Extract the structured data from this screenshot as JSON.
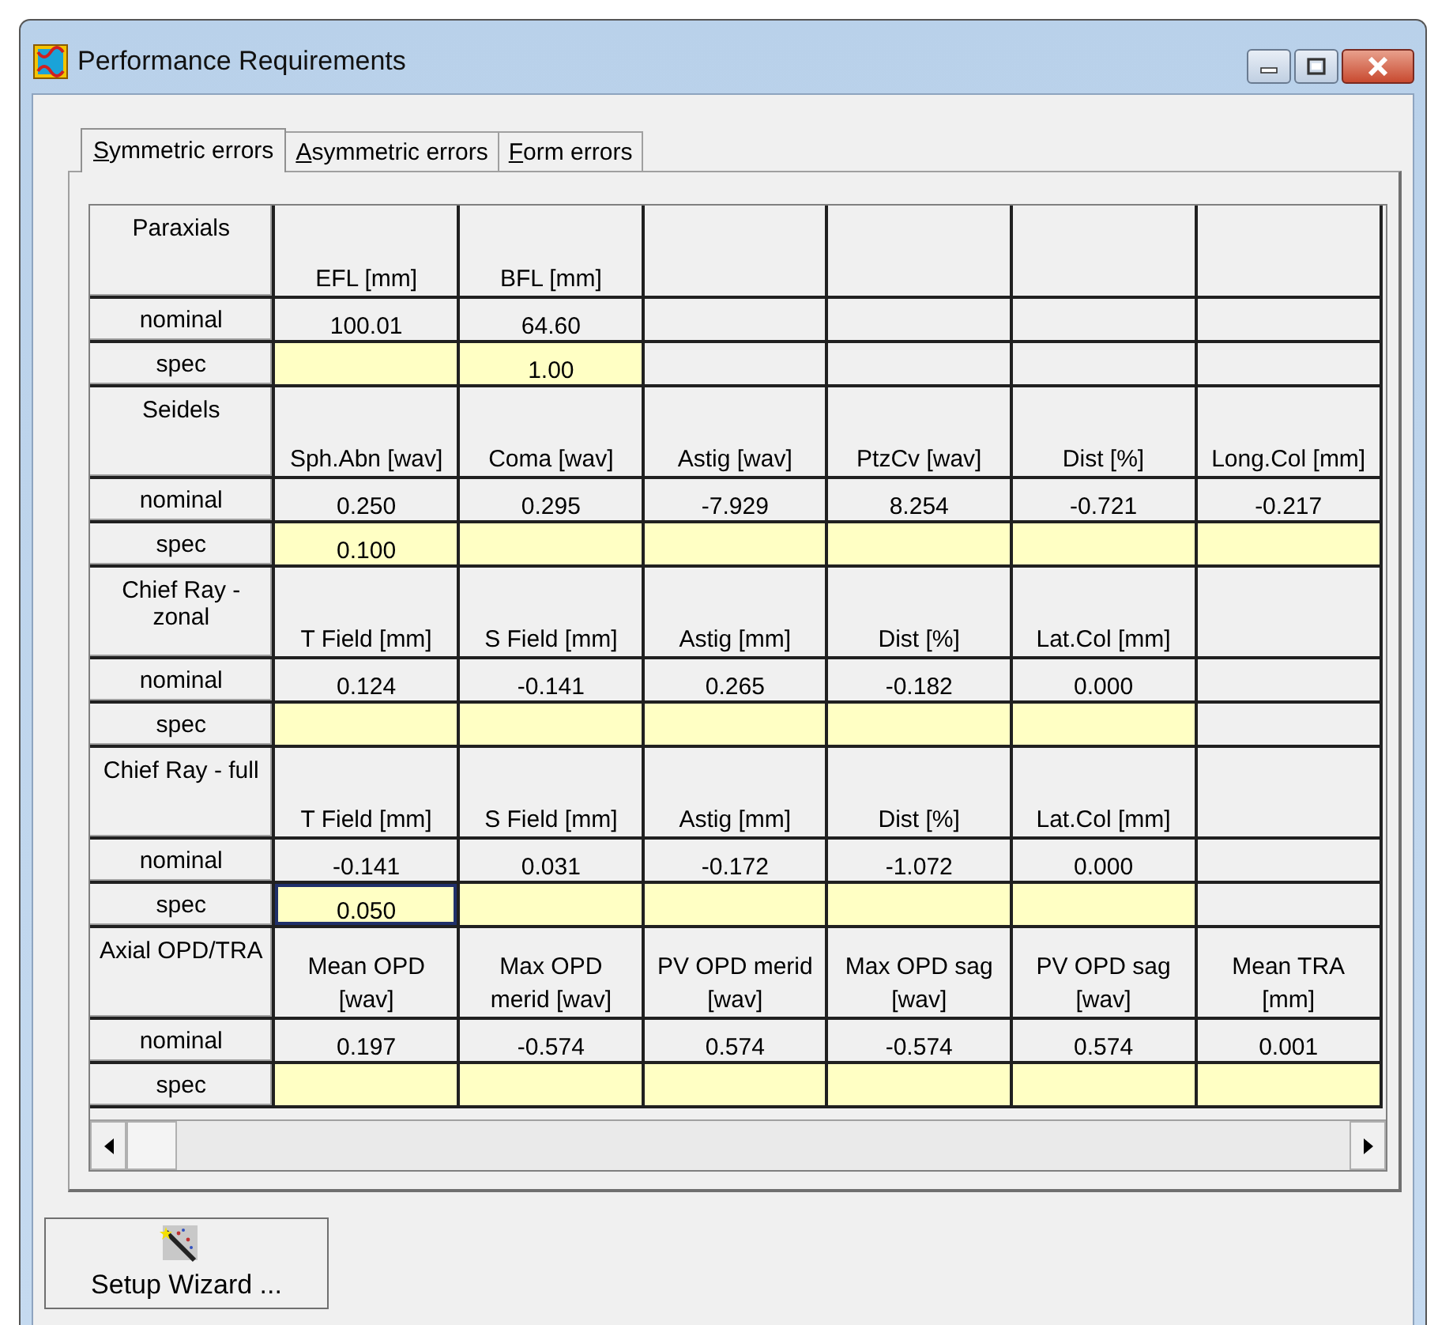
{
  "window": {
    "title": "Performance Requirements"
  },
  "tabs": [
    {
      "label": "Symmetric errors",
      "selected": true
    },
    {
      "label": "Asymmetric errors",
      "selected": false
    },
    {
      "label": "Form errors",
      "selected": false
    }
  ],
  "table": {
    "sections": [
      {
        "label": "Paraxials",
        "nominal_label": "nominal",
        "spec_label": "spec",
        "columns": [
          {
            "heading": "EFL [mm]",
            "nominal": "100.01",
            "spec": {
              "editable": true,
              "selected": false
            }
          },
          {
            "heading": "BFL [mm]",
            "nominal": "64.60",
            "spec": {
              "value": "1.00",
              "editable": true,
              "selected": false
            }
          }
        ]
      },
      {
        "label": "Seidels",
        "nominal_label": "nominal",
        "spec_label": "spec",
        "columns": [
          {
            "heading": "Sph.Abn [wav]",
            "nominal": "0.250",
            "spec": {
              "value": "0.100",
              "editable": true,
              "selected": false
            }
          },
          {
            "heading": "Coma [wav]",
            "nominal": "0.295",
            "spec": {
              "editable": true,
              "selected": false
            }
          },
          {
            "heading": "Astig [wav]",
            "nominal": "-7.929",
            "spec": {
              "editable": true,
              "selected": false
            }
          },
          {
            "heading": "PtzCv [wav]",
            "nominal": "8.254",
            "spec": {
              "editable": true,
              "selected": false
            }
          },
          {
            "heading": "Dist [%]",
            "nominal": "-0.721",
            "spec": {
              "editable": true,
              "selected": false
            }
          },
          {
            "heading": "Long.Col [mm]",
            "nominal": "-0.217",
            "spec": {
              "editable": true,
              "selected": false
            }
          }
        ]
      },
      {
        "label": "Chief Ray - zonal",
        "nominal_label": "nominal",
        "spec_label": "spec",
        "columns": [
          {
            "heading": "T Field [mm]",
            "nominal": "0.124",
            "spec": {
              "editable": true,
              "selected": false
            }
          },
          {
            "heading": "S Field [mm]",
            "nominal": "-0.141",
            "spec": {
              "editable": true,
              "selected": false
            }
          },
          {
            "heading": "Astig [mm]",
            "nominal": "0.265",
            "spec": {
              "editable": true,
              "selected": false
            }
          },
          {
            "heading": "Dist [%]",
            "nominal": "-0.182",
            "spec": {
              "editable": true,
              "selected": false
            }
          },
          {
            "heading": "Lat.Col [mm]",
            "nominal": "0.000",
            "spec": {
              "editable": true,
              "selected": false
            }
          }
        ]
      },
      {
        "label": "Chief Ray - full",
        "nominal_label": "nominal",
        "spec_label": "spec",
        "columns": [
          {
            "heading": "T Field [mm]",
            "nominal": "-0.141",
            "spec": {
              "value": "0.050",
              "editable": true,
              "selected": true
            }
          },
          {
            "heading": "S Field [mm]",
            "nominal": "0.031",
            "spec": {
              "editable": true,
              "selected": false
            }
          },
          {
            "heading": "Astig [mm]",
            "nominal": "-0.172",
            "spec": {
              "editable": true,
              "selected": false
            }
          },
          {
            "heading": "Dist [%]",
            "nominal": "-1.072",
            "spec": {
              "editable": true,
              "selected": false
            }
          },
          {
            "heading": "Lat.Col [mm]",
            "nominal": "0.000",
            "spec": {
              "editable": true,
              "selected": false
            }
          }
        ]
      },
      {
        "label": "Axial OPD/TRA",
        "nominal_label": "nominal",
        "spec_label": "spec",
        "columns": [
          {
            "heading": "Mean OPD [wav]",
            "nominal": "0.197",
            "spec": {
              "editable": true,
              "selected": false
            }
          },
          {
            "heading": "Max OPD merid [wav]",
            "nominal": "-0.574",
            "spec": {
              "editable": true,
              "selected": false
            }
          },
          {
            "heading": "PV OPD merid [wav]",
            "nominal": "0.574",
            "spec": {
              "editable": true,
              "selected": false
            }
          },
          {
            "heading": "Max OPD sag [wav]",
            "nominal": "-0.574",
            "spec": {
              "editable": true,
              "selected": false
            }
          },
          {
            "heading": "PV OPD sag [wav]",
            "nominal": "0.574",
            "spec": {
              "editable": true,
              "selected": false
            }
          },
          {
            "heading": "Mean TRA [mm]",
            "nominal": "0.001",
            "spec": {
              "editable": true,
              "selected": false
            }
          }
        ]
      }
    ]
  },
  "buttons": [
    {
      "label": "Setup Wizard ..."
    }
  ]
}
